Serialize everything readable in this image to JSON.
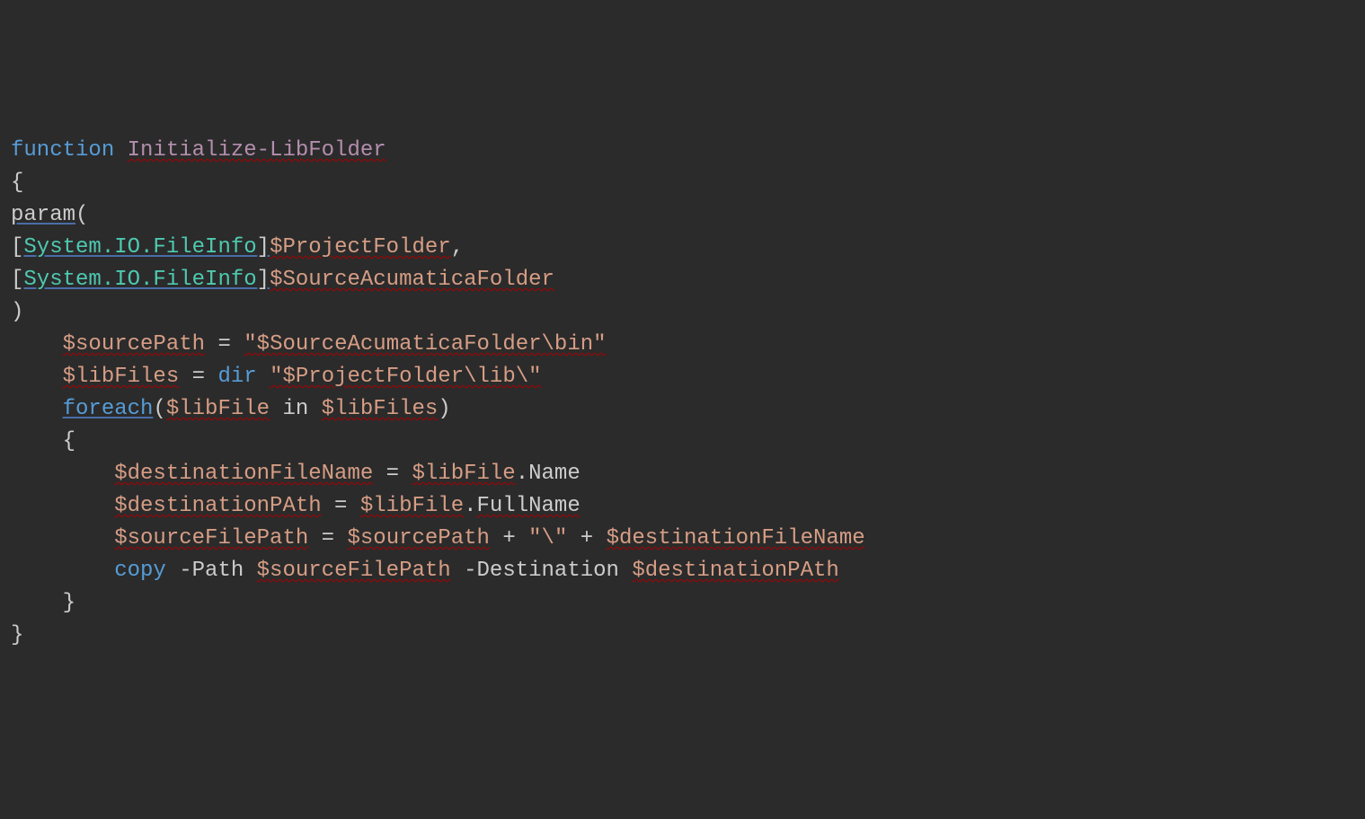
{
  "code": {
    "t1": "function",
    "t2": " ",
    "t3": "Initialize-LibFolder",
    "t4": "{",
    "t5": "param",
    "t6": "(",
    "t7": "[",
    "t8": "System.IO.FileInfo",
    "t9": "]",
    "t10": "$ProjectFolder",
    "t11": ",",
    "t12": "[",
    "t13": "System.IO.FileInfo",
    "t14": "]",
    "t15": "$SourceAcumaticaFolder",
    "t16": ")",
    "t17": "    ",
    "t18": "$sourcePath",
    "t19": " = ",
    "t20": "\"$SourceAcumaticaFolder\\bin\"",
    "t21": "    ",
    "t22": "$libFiles",
    "t23": " = ",
    "t24": "dir",
    "t25": " ",
    "t26": "\"$ProjectFolder\\lib\\\"",
    "t27": "    ",
    "t28": "foreach",
    "t29": "(",
    "t30": "$libFile",
    "t31": " in ",
    "t32": "$libFiles",
    "t33": ")",
    "t34": "    {",
    "t35": "        ",
    "t36": "$destinationFileName",
    "t37": " = ",
    "t38": "$libFile",
    "t39": ".",
    "t40": "Name",
    "t41": "        ",
    "t42": "$destinationPAth",
    "t43": " = ",
    "t44": "$libFile",
    "t45": ".",
    "t46": "FullName",
    "t47": "        ",
    "t48": "$sourceFilePath",
    "t49": " = ",
    "t50": "$sourcePath",
    "t51": " + ",
    "t52": "\"\\\"",
    "t53": " + ",
    "t54": "$destinationFileName",
    "t55": "        ",
    "t56": "copy",
    "t57": " -Path ",
    "t58": "$sourceFilePath",
    "t59": " -Destination ",
    "t60": "$destinationPAth",
    "t61": "    }",
    "t62": "}"
  },
  "colors": {
    "bg": "#2b2b2b",
    "keyword": "#569cd6",
    "function": "#b48ead",
    "type": "#4ec9b0",
    "variable": "#d69d85",
    "text": "#cccccc"
  }
}
